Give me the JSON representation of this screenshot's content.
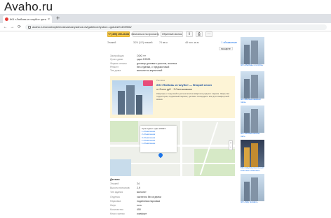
{
  "watermark": "Avaho.ru",
  "browser": {
    "tab_title": "ЖК «Любовь и голуби» цены",
    "tab_close": "×",
    "new_tab": "+",
    "url": "avaho.ru/novostroyki/moskva/razryadnoe-dvigatelnoe/lyubov-i-golubi/21439906/",
    "nav": {
      "back": "←",
      "forward": "→",
      "reload": "⟳"
    }
  },
  "actions": {
    "phone": "+7 (495) 150-16-84",
    "favorite": "Записаться на просмотр",
    "consult": "Обратный звонок",
    "share": "⇪",
    "print": "⎙",
    "more": "⋯"
  },
  "stats": {
    "items": [
      "Этажей",
      "3/24 (1/2) этажей",
      "74 кв.м",
      "48 пол. кв.м"
    ],
    "link": "1 объявление",
    "button": "на карте"
  },
  "params": [
    {
      "k": "Застройщик",
      "v": "ООО «»"
    },
    {
      "k": "Срок сдачи",
      "v": "сдан 2/2023"
    },
    {
      "k": "Форма оплаты",
      "v": "договор долевого участия, ипотека"
    },
    {
      "k": "Ремонт",
      "v": "без отделки, с предчистовой"
    },
    {
      "k": "Тип дома",
      "v": "монолитно-кирпичный"
    }
  ],
  "promo": {
    "tag": "Реклама",
    "title": "ЖК «Любовь и голуби» — Второй сезон",
    "price": "от 8 млн руб. · 3 Салтыковская",
    "desc": "Квартиры с отделкой в уютном жилом квартале рядом с парком. Закрытая территория, подземный паркинг, детские площадки и всё для комфортной жизни."
  },
  "map": {
    "popup_title": "Срок сдачи: сдан 2/2023",
    "popup_links": [
      "1 объявление",
      "2 объявления",
      "3 объявления",
      "1 объявление",
      "1 объявление"
    ],
    "zoom_in": "+",
    "zoom_out": "−"
  },
  "details": {
    "header": "Детали",
    "rows": [
      {
        "k": "Этажей",
        "v": "24"
      },
      {
        "k": "Высота потолков",
        "v": "2,9"
      },
      {
        "k": "Тип здания",
        "v": "монолит"
      },
      {
        "k": "Отделка",
        "v": "частично без отделки"
      },
      {
        "k": "Парковка",
        "v": "подземная парковка"
      },
      {
        "k": "Лифт",
        "v": "есть"
      },
      {
        "k": "Количество",
        "v": "450"
      },
      {
        "k": "Класс жилья",
        "v": "комфорт"
      }
    ]
  },
  "sidebar": [
    {
      "caption": "ЖК «Любовь и голуби»",
      "dark": false
    },
    {
      "caption": "ЖК «Волоколамский парк»",
      "dark": false
    },
    {
      "caption": "ЖК «Измайловский лес»",
      "dark": false
    },
    {
      "caption": "Многофункциональный комплекс «Рассвет»",
      "dark": true
    },
    {
      "caption": "ЖК «Sky Garden»",
      "dark": false
    }
  ]
}
